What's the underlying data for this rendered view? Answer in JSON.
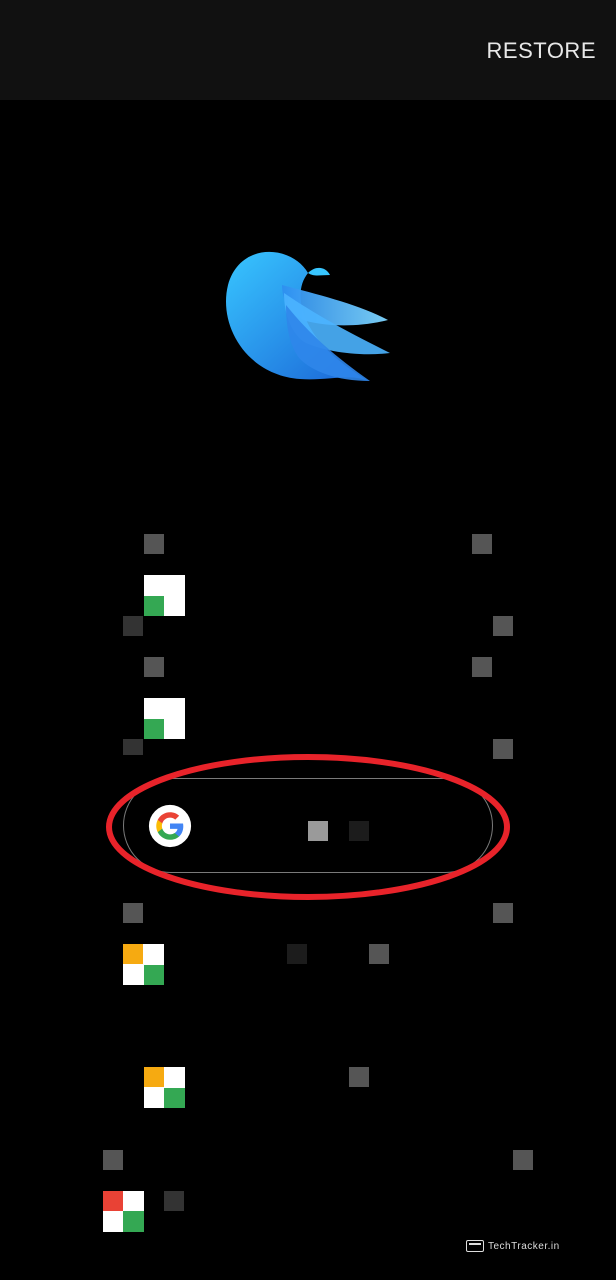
{
  "header": {
    "restore_label": "RESTORE"
  },
  "logo": {
    "icon": "bird-logo",
    "colors": [
      "#1fa4f0",
      "#1565d8",
      "#7fd3ff"
    ]
  },
  "login": {
    "google_icon": "google-g-icon"
  },
  "annotation": {
    "shape": "ellipse",
    "color": "#e8232a"
  },
  "watermark": {
    "text": "TechTracker.in"
  }
}
